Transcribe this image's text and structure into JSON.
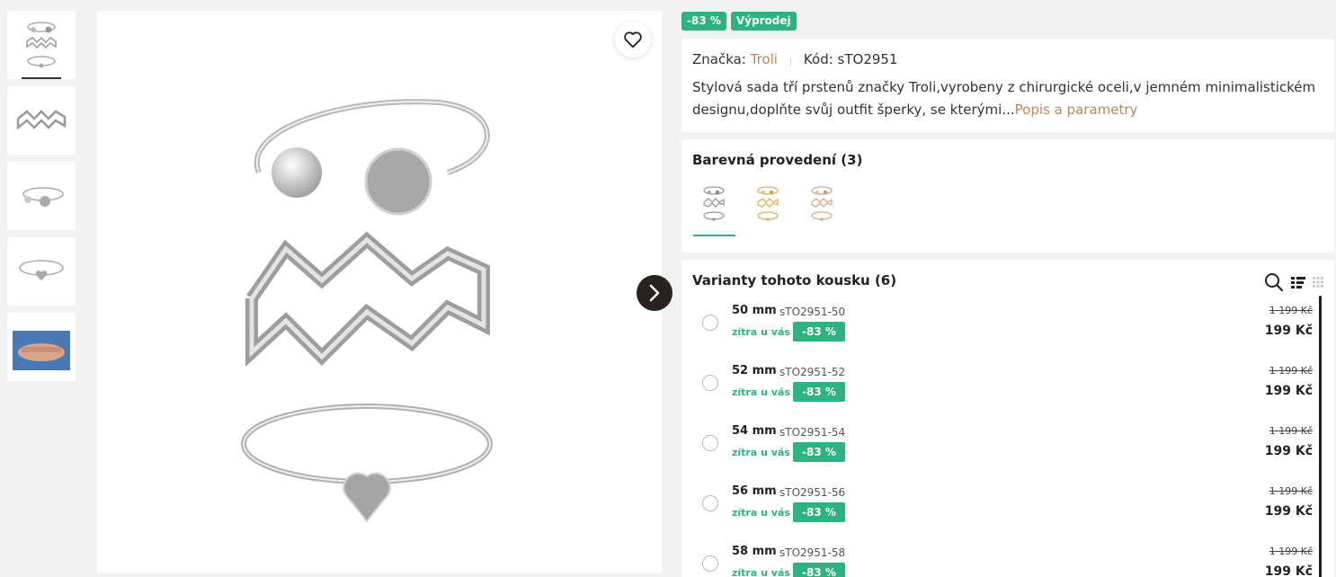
{
  "badges": {
    "discount": "-83 %",
    "sale": "Výprodej"
  },
  "info": {
    "brand_label": "Značka:",
    "brand_name": "Troli",
    "code_label": "Kód: sTO2951",
    "description": "Stylová sada tří prstenů značky Troli,vyrobeny z chirurgické oceli,v jemném minimalistickém designu,doplňte svůj outfit šperky, se kterými...",
    "more_link": "Popis a parametry"
  },
  "colors": {
    "title": "Barevná provedení (3)",
    "options": [
      "silver",
      "gold",
      "rose-gold"
    ]
  },
  "variants": {
    "title": "Varianty tohoto kousku (6)",
    "rows": [
      {
        "size": "50 mm",
        "code": "sTO2951-50",
        "availability": "zítra u vás",
        "discount": "-83 %",
        "old_price": "1 199 Kč",
        "price": "199 Kč"
      },
      {
        "size": "52 mm",
        "code": "sTO2951-52",
        "availability": "zítra u vás",
        "discount": "-83 %",
        "old_price": "1 199 Kč",
        "price": "199 Kč"
      },
      {
        "size": "54 mm",
        "code": "sTO2951-54",
        "availability": "zítra u vás",
        "discount": "-83 %",
        "old_price": "1 199 Kč",
        "price": "199 Kč"
      },
      {
        "size": "56 mm",
        "code": "sTO2951-56",
        "availability": "zítra u vás",
        "discount": "-83 %",
        "old_price": "1 199 Kč",
        "price": "199 Kč"
      },
      {
        "size": "58 mm",
        "code": "sTO2951-58",
        "availability": "zítra u vás",
        "discount": "-83 %",
        "old_price": "1 199 Kč",
        "price": "199 Kč"
      }
    ]
  },
  "icons": {
    "favorite": "heart-icon",
    "next": "chevron-right-icon",
    "search": "search-icon",
    "list_view": "list-view-icon",
    "grid_view": "grid-view-icon"
  },
  "colors_palette": {
    "accent": "#2db37f",
    "brand_link": "#c0855a",
    "dark_button": "#2a2220"
  }
}
